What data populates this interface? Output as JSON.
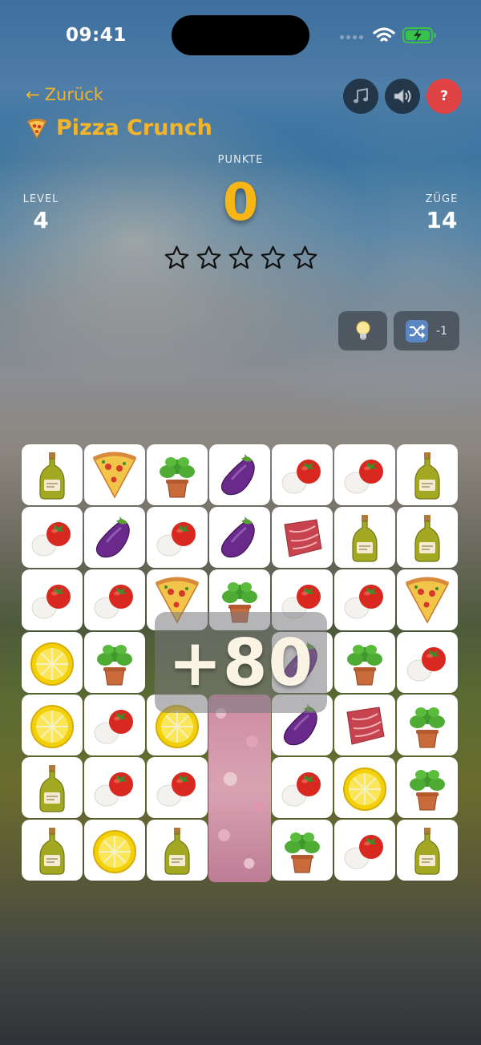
{
  "status_bar": {
    "time": "09:41",
    "battery_color": "#37c24a"
  },
  "header": {
    "back_label": "Zurück",
    "title": "Pizza Crunch",
    "title_icon": "pizza-slice-icon",
    "accent_color": "#f4b42a",
    "buttons": [
      {
        "name": "music",
        "icon": "music-note-icon"
      },
      {
        "name": "sound",
        "icon": "speaker-icon"
      },
      {
        "name": "help",
        "label": "?",
        "color": "#e04343"
      }
    ]
  },
  "score": {
    "label": "PUNKTE",
    "value": "0"
  },
  "level": {
    "label": "LEVEL",
    "value": "4"
  },
  "moves": {
    "label": "ZÜGE",
    "value": "14"
  },
  "stars": {
    "filled": 0,
    "total": 5
  },
  "tools": {
    "hint": {
      "icon": "lightbulb-icon"
    },
    "shuffle": {
      "icon": "shuffle-icon",
      "count_label": "-1"
    }
  },
  "board": {
    "rows": 7,
    "cols": 7,
    "grid": [
      [
        "oil",
        "pizza",
        "basil",
        "eggplant",
        "tomato",
        "tomato",
        "oil"
      ],
      [
        "tomato",
        "eggplant",
        "tomato",
        "eggplant",
        "ham",
        "oil",
        "oil"
      ],
      [
        "tomato",
        "tomato",
        "pizza",
        "basil",
        "tomato",
        "tomato",
        "pizza"
      ],
      [
        "lemon",
        "basil",
        "",
        "",
        "eggplant",
        "basil",
        "tomato"
      ],
      [
        "lemon",
        "tomato",
        "lemon",
        "",
        "eggplant",
        "ham",
        "basil"
      ],
      [
        "oil",
        "tomato",
        "tomato",
        "",
        "tomato",
        "lemon",
        "basil"
      ],
      [
        "oil",
        "lemon",
        "oil",
        "",
        "basil",
        "tomato",
        "oil"
      ]
    ]
  },
  "popup": {
    "text": "+80"
  }
}
